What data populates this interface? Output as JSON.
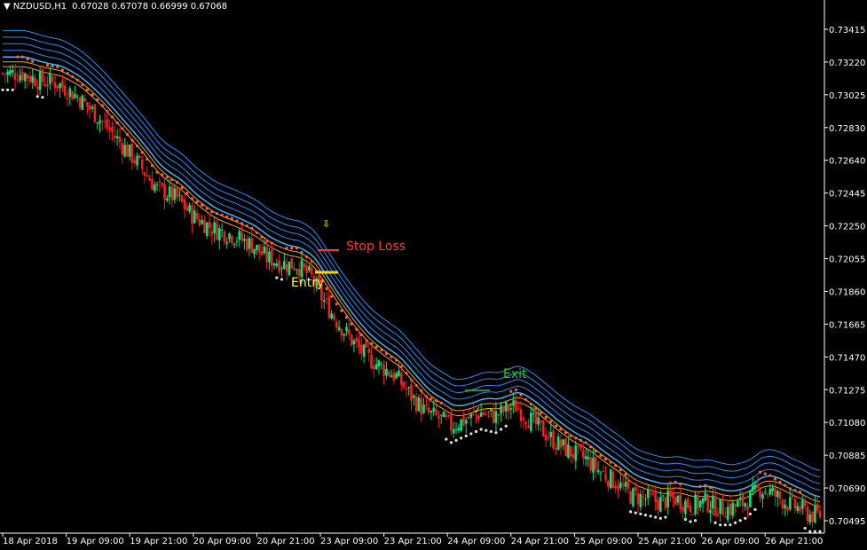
{
  "header": {
    "dropdown_icon": "triangle-down-icon",
    "symbol": "NZDUSD,H1",
    "ohlc": "0.67028 0.67078 0.66999 0.67068"
  },
  "colors": {
    "background": "#000000",
    "bull_candle": "#00e57a",
    "bear_candle": "#ff1a1a",
    "orange_band": "#ffa500",
    "blue_band": "#1e90ff",
    "dots_bear": "#ff6347",
    "dots_bull": "#e0e0e0",
    "axis": "#ffffff"
  },
  "annotations": {
    "stop_loss": "Stop Loss",
    "entry": "Entry",
    "exit": "Exit",
    "signal_arrow_icon": "down-arrow-icon",
    "exit_check_icon": "checkmark-icon"
  },
  "chart_data": {
    "type": "candlestick",
    "symbol": "NZDUSD",
    "timeframe": "H1",
    "y_ticks": [
      "0.73415",
      "0.73220",
      "0.73025",
      "0.72830",
      "0.72640",
      "0.72445",
      "0.72250",
      "0.72055",
      "0.71860",
      "0.71665",
      "0.71470",
      "0.71275",
      "0.71080",
      "0.70885",
      "0.70690",
      "0.70495"
    ],
    "x_ticks": [
      "18 Apr 2018",
      "19 Apr 09:00",
      "19 Apr 21:00",
      "20 Apr 09:00",
      "20 Apr 21:00",
      "23 Apr 09:00",
      "23 Apr 21:00",
      "24 Apr 09:00",
      "24 Apr 21:00",
      "25 Apr 09:00",
      "25 Apr 21:00",
      "26 Apr 09:00",
      "26 Apr 21:00"
    ],
    "ylim": [
      0.7043,
      0.7359
    ],
    "close_path": [
      [
        0,
        0.7322
      ],
      [
        8,
        0.7322
      ],
      [
        14,
        0.7318
      ],
      [
        22,
        0.7316
      ],
      [
        30,
        0.7308
      ],
      [
        38,
        0.7296
      ],
      [
        46,
        0.7282
      ],
      [
        54,
        0.7268
      ],
      [
        62,
        0.7252
      ],
      [
        70,
        0.7246
      ],
      [
        76,
        0.7236
      ],
      [
        84,
        0.7228
      ],
      [
        92,
        0.7224
      ],
      [
        100,
        0.7218
      ],
      [
        106,
        0.721
      ],
      [
        110,
        0.7208
      ],
      [
        114,
        0.7206
      ],
      [
        118,
        0.7206
      ],
      [
        124,
        0.7198
      ],
      [
        128,
        0.7186
      ],
      [
        134,
        0.7172
      ],
      [
        140,
        0.716
      ],
      [
        146,
        0.715
      ],
      [
        152,
        0.7144
      ],
      [
        158,
        0.7138
      ],
      [
        164,
        0.7126
      ],
      [
        170,
        0.7116
      ],
      [
        176,
        0.7112
      ],
      [
        180,
        0.7108
      ],
      [
        186,
        0.7112
      ],
      [
        192,
        0.7116
      ],
      [
        198,
        0.7114
      ],
      [
        202,
        0.7118
      ],
      [
        206,
        0.712
      ],
      [
        210,
        0.7114
      ],
      [
        216,
        0.7106
      ],
      [
        222,
        0.7098
      ],
      [
        228,
        0.7092
      ],
      [
        234,
        0.7088
      ],
      [
        240,
        0.708
      ],
      [
        246,
        0.7074
      ],
      [
        252,
        0.7066
      ],
      [
        258,
        0.7064
      ],
      [
        264,
        0.7062
      ],
      [
        270,
        0.7064
      ],
      [
        276,
        0.706
      ],
      [
        282,
        0.7062
      ],
      [
        288,
        0.7058
      ],
      [
        292,
        0.7058
      ],
      [
        298,
        0.7062
      ],
      [
        304,
        0.707
      ],
      [
        308,
        0.7068
      ],
      [
        312,
        0.7064
      ],
      [
        316,
        0.706
      ],
      [
        320,
        0.7058
      ],
      [
        324,
        0.7054
      ],
      [
        328,
        0.7054
      ]
    ],
    "price_levels": {
      "stop_loss": 0.7213,
      "entry": 0.7203
    },
    "indicators": [
      "EMA band (orange)",
      "EMA band (blue)",
      "Parabolic SAR dots"
    ]
  }
}
